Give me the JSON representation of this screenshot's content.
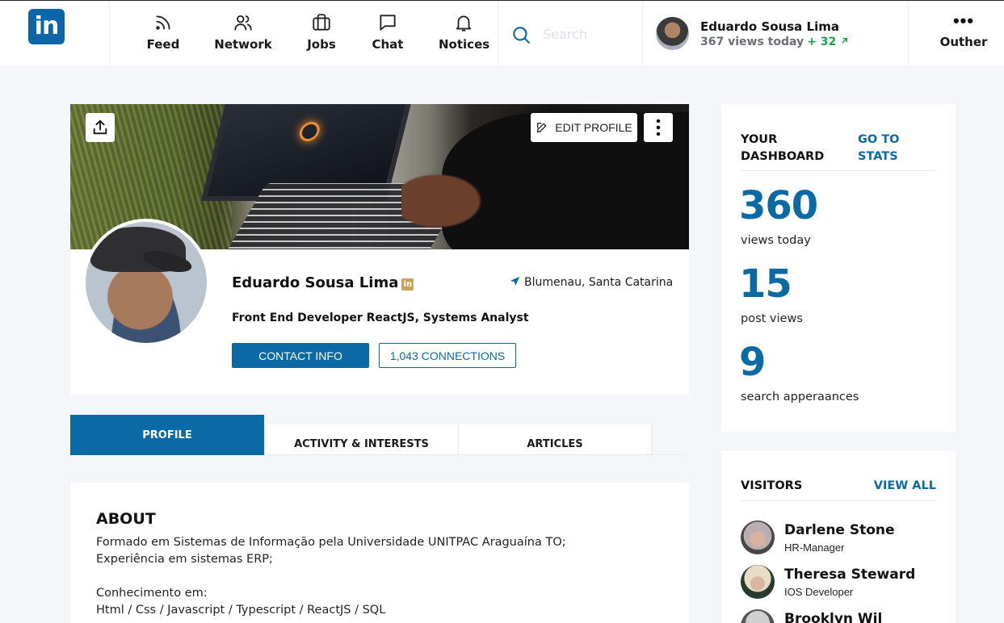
{
  "header": {
    "logo_text": "in",
    "nav": [
      {
        "label": "Feed",
        "icon": "rss-icon"
      },
      {
        "label": "Network",
        "icon": "users-icon"
      },
      {
        "label": "Jobs",
        "icon": "briefcase-icon"
      },
      {
        "label": "Chat",
        "icon": "message-icon"
      },
      {
        "label": "Notices",
        "icon": "bell-icon"
      }
    ],
    "search_placeholder": "Search",
    "user": {
      "name": "Eduardo Sousa Lima",
      "views_text": "367 views today",
      "delta_text": "+ 32",
      "delta_color": "#16a34a"
    },
    "other_label": "Outher"
  },
  "profile": {
    "edit_label": "EDIT PROFILE",
    "name": "Eduardo Sousa Lima",
    "badge": "in",
    "location": "Blumenau, Santa Catarina",
    "title": "Front End Developer ReactJS, Systems Analyst",
    "contact_label": "CONTACT INFO",
    "connections_label": "1,043 CONNECTIONS"
  },
  "tabs": [
    {
      "label": "PROFILE",
      "active": true
    },
    {
      "label": "ACTIVITY & INTERESTS",
      "active": false
    },
    {
      "label": "ARTICLES",
      "active": false
    }
  ],
  "about": {
    "heading": "ABOUT",
    "lines": [
      "Formado em Sistemas de Informação pela Universidade UNITPAC Araguaína TO;",
      "Experiência em sistemas ERP;",
      "",
      "Conhecimento em:",
      "Html / Css / Javascript / Typescript / ReactJS / SQL"
    ]
  },
  "dashboard": {
    "title": "YOUR DASHBOARD",
    "link": "GO TO STATS",
    "stats": [
      {
        "value": "360",
        "label": "views today"
      },
      {
        "value": "15",
        "label": "post views"
      },
      {
        "value": "9",
        "label": "search apperaances"
      }
    ]
  },
  "visitors": {
    "title": "VISITORS",
    "link": "VIEW ALL",
    "items": [
      {
        "name": "Darlene Stone",
        "role": "HR-Manager"
      },
      {
        "name": "Theresa Steward",
        "role": "IOS Developer"
      },
      {
        "name": "Brooklyn Wil",
        "role": ""
      }
    ]
  },
  "colors": {
    "accent": "#0a6aa6",
    "background": "#f4f6f9",
    "positive": "#16a34a"
  }
}
